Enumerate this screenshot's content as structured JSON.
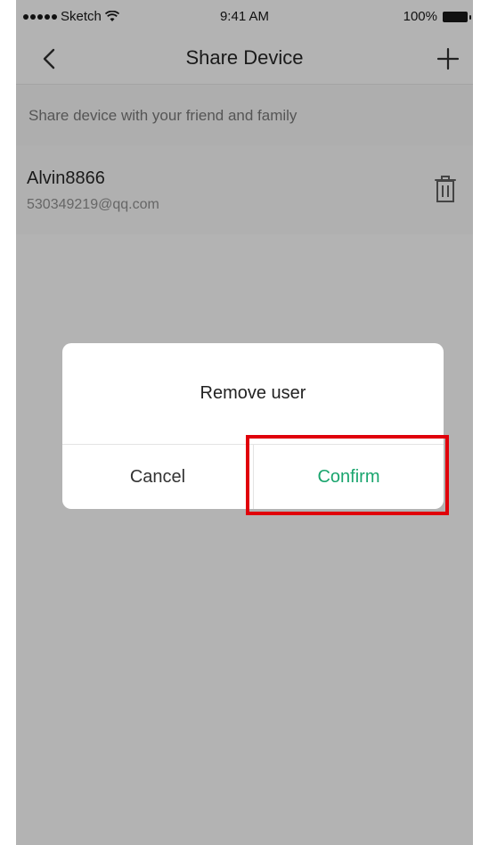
{
  "status_bar": {
    "carrier": "Sketch",
    "time": "9:41 AM",
    "battery": "100%"
  },
  "nav": {
    "title": "Share Device",
    "back_icon": "chevron-left-icon",
    "add_icon": "plus-icon"
  },
  "subtitle": "Share device with your friend and family",
  "shared_user": {
    "name": "Alvin8866",
    "email": "530349219@qq.com",
    "delete_icon": "trash-icon"
  },
  "dialog": {
    "title": "Remove user",
    "cancel_label": "Cancel",
    "confirm_label": "Confirm"
  },
  "colors": {
    "accent": "#1aa56e",
    "overlay": "#b3b3b3",
    "highlight": "#e0000a"
  }
}
